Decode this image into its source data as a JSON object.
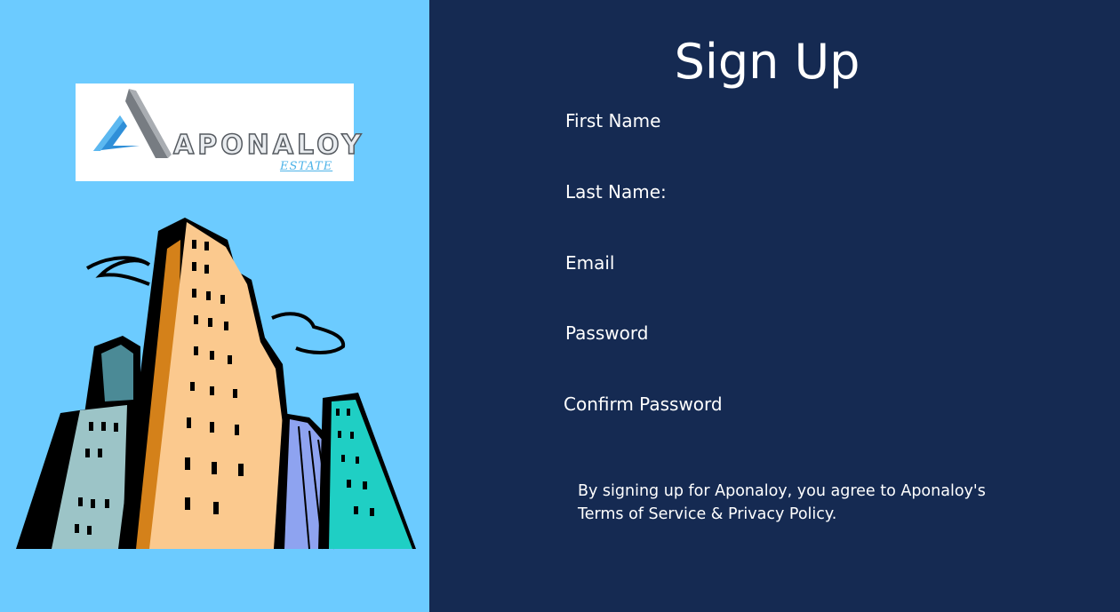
{
  "brand": {
    "name": "APONALOY",
    "subtitle": "ESTATE",
    "logo_icon": "triangle-a-logo-icon",
    "illustration": "city-buildings-illustration"
  },
  "form": {
    "title": "Sign Up",
    "fields": [
      {
        "label": "First Name"
      },
      {
        "label": "Last Name:"
      },
      {
        "label": "Email"
      },
      {
        "label": "Password"
      },
      {
        "label": "Confirm Password"
      }
    ],
    "terms_line1": "By signing up for Aponaloy, you agree to Aponaloy's",
    "terms_line2": "Terms of Service & Privacy Policy."
  },
  "colors": {
    "left_background": "#6ccbff",
    "right_background": "#152a52",
    "text": "#ffffff"
  }
}
